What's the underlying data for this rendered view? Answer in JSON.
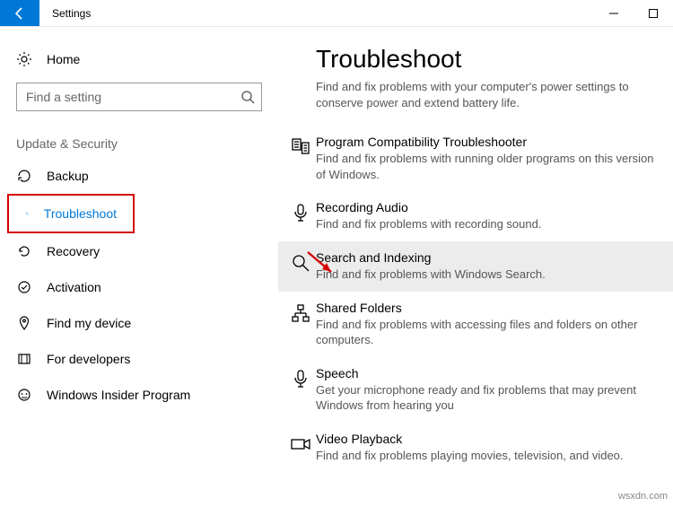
{
  "window": {
    "title": "Settings"
  },
  "sidebar": {
    "home": "Home",
    "search_placeholder": "Find a setting",
    "section": "Update & Security",
    "items": [
      {
        "label": "Backup"
      },
      {
        "label": "Troubleshoot"
      },
      {
        "label": "Recovery"
      },
      {
        "label": "Activation"
      },
      {
        "label": "Find my device"
      },
      {
        "label": "For developers"
      },
      {
        "label": "Windows Insider Program"
      }
    ]
  },
  "main": {
    "heading": "Troubleshoot",
    "lead": "Find and fix problems with your computer's power settings to conserve power and extend battery life.",
    "items": [
      {
        "title": "Program Compatibility Troubleshooter",
        "desc": "Find and fix problems with running older programs on this version of Windows."
      },
      {
        "title": "Recording Audio",
        "desc": "Find and fix problems with recording sound."
      },
      {
        "title": "Search and Indexing",
        "desc": "Find and fix problems with Windows Search."
      },
      {
        "title": "Shared Folders",
        "desc": "Find and fix problems with accessing files and folders on other computers."
      },
      {
        "title": "Speech",
        "desc": "Get your microphone ready and fix problems that may prevent Windows from hearing you"
      },
      {
        "title": "Video Playback",
        "desc": "Find and fix problems playing movies, television, and video."
      }
    ]
  },
  "watermark": "wsxdn.com"
}
